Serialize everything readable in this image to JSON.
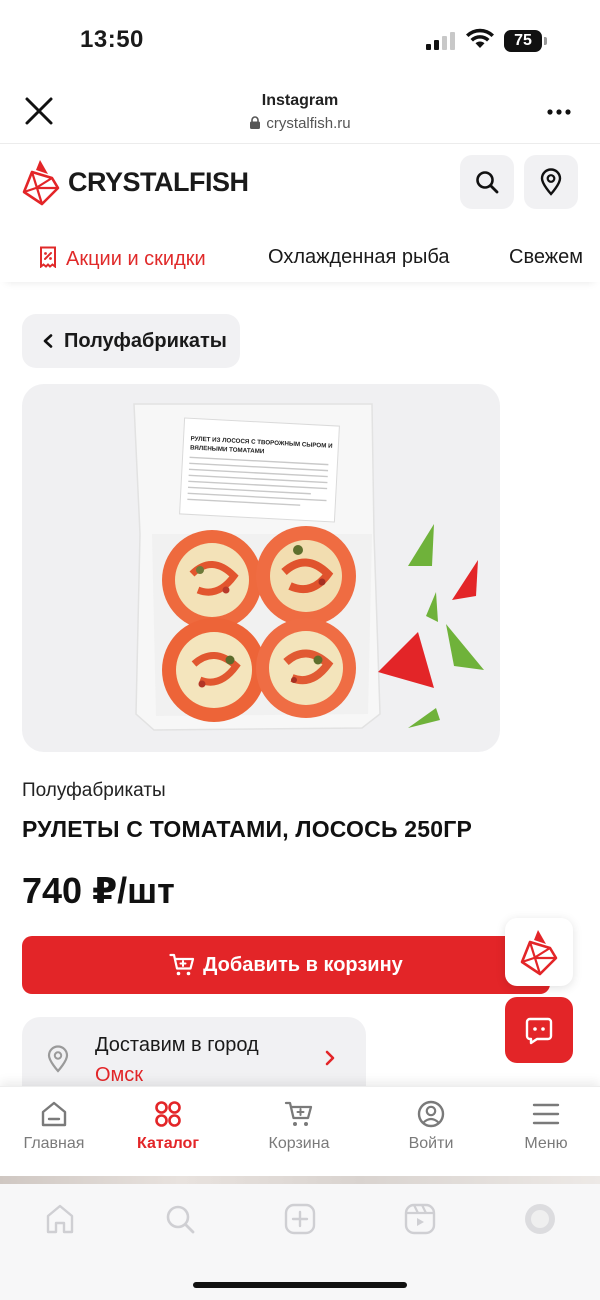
{
  "status_bar": {
    "time": "13:50",
    "battery": "75"
  },
  "browser": {
    "title": "Instagram",
    "url": "crystalfish.ru"
  },
  "site": {
    "brand": "CRYSTALFISH"
  },
  "categories": [
    {
      "label": "Акции и скидки"
    },
    {
      "label": "Охлажденная рыба"
    },
    {
      "label": "Свежем"
    }
  ],
  "back": {
    "label": "Полуфабрикаты"
  },
  "product": {
    "category": "Полуфабрикаты",
    "title": "РУЛЕТЫ С ТОМАТАМИ, ЛОСОСЬ 250ГР",
    "price": "740 ₽/шт",
    "add_to_cart": "Добавить в корзину",
    "package_label_line1": "РУЛЕТ ИЗ ЛОСОСЯ С ТВОРОЖНЫМ СЫРОМ И",
    "package_label_line2": "ВЯЛЕНЫМИ ТОМАТАМИ"
  },
  "delivery": {
    "label": "Доставим в город",
    "city": "Омск"
  },
  "site_nav": [
    {
      "label": "Главная",
      "icon": "home-icon"
    },
    {
      "label": "Каталог",
      "icon": "catalog-icon",
      "active": true
    },
    {
      "label": "Корзина",
      "icon": "cart-icon"
    },
    {
      "label": "Войти",
      "icon": "user-icon"
    },
    {
      "label": "Меню",
      "icon": "menu-icon"
    }
  ],
  "colors": {
    "accent": "#e32528",
    "green": "#6fb23a",
    "chip_bg": "#f1f1f3"
  }
}
